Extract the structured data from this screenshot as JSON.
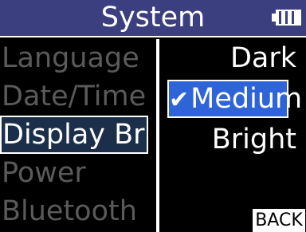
{
  "header": {
    "title": "System",
    "battery_icon": "battery-full-icon"
  },
  "menu": {
    "items": [
      {
        "label": "Language"
      },
      {
        "label": "Date/Time"
      },
      {
        "label": "Display Br",
        "selected": true
      },
      {
        "label": "Power"
      },
      {
        "label": "Bluetooth"
      }
    ]
  },
  "options": {
    "items": [
      {
        "label": "Dark"
      },
      {
        "label": "Medium",
        "selected": true,
        "check_icon": "✔"
      },
      {
        "label": "Bright"
      }
    ]
  },
  "back": {
    "label": "BACK"
  },
  "colors": {
    "header_bg": "#3b3f7f",
    "selected_menu_bg": "#1b2e4a",
    "selected_option_bg": "#2f63d8",
    "inactive_text": "#5a5a5a"
  }
}
